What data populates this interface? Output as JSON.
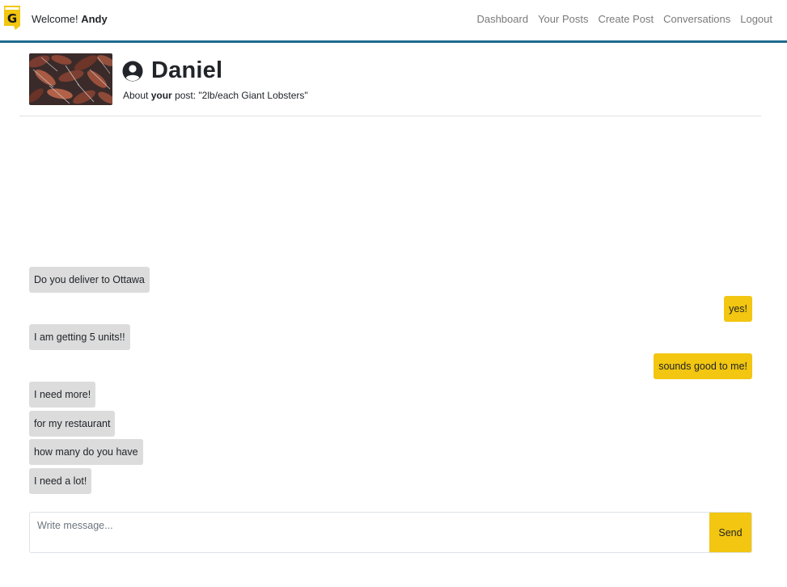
{
  "navbar": {
    "logo_letter": "G",
    "welcome_prefix": "Welcome!",
    "username": "Andy",
    "links": [
      "Dashboard",
      "Your Posts",
      "Create Post",
      "Conversations",
      "Logout"
    ]
  },
  "conversation": {
    "contact_name": "Daniel",
    "about_prefix": "About",
    "about_owner": "your",
    "about_middle": "post:",
    "post_title": "\"2lb/each Giant Lobsters\""
  },
  "messages": [
    {
      "text": "Do you deliver to Ottawa",
      "direction": "in"
    },
    {
      "text": "yes!",
      "direction": "out"
    },
    {
      "text": "I am getting 5 units!!",
      "direction": "in"
    },
    {
      "text": "sounds good to me!",
      "direction": "out"
    },
    {
      "text": "I need more!",
      "direction": "in"
    },
    {
      "text": "for my restaurant",
      "direction": "in"
    },
    {
      "text": "how many do you have",
      "direction": "in"
    },
    {
      "text": "I need a lot!",
      "direction": "in"
    }
  ],
  "composer": {
    "placeholder": "Write message...",
    "value": "",
    "send_label": "Send"
  },
  "colors": {
    "accent_yellow": "#f2c611",
    "incoming_bubble": "#dcdcdc",
    "navbar_border": "#1f6b8f",
    "nav_link": "#7a7a7a"
  }
}
